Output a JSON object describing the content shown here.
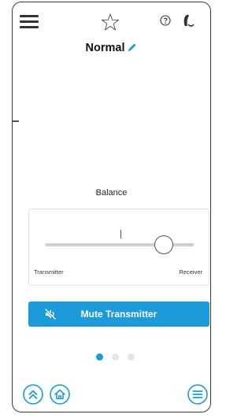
{
  "header": {
    "icons": [
      "menu-icon",
      "star-icon",
      "help-icon",
      "hearing-aid-icon"
    ]
  },
  "program": {
    "name": "Normal",
    "edit_icon": "pencil-icon"
  },
  "balance": {
    "title": "Balance",
    "left_label": "Transmitter",
    "right_label": "Receiver",
    "value_fraction": 0.8
  },
  "mute_button": {
    "label": "Mute Transmitter",
    "icon": "speaker-muted-icon"
  },
  "pager": {
    "count": 3,
    "active_index": 0
  },
  "bottom_bar": {
    "icons": [
      "chevron-double-up-icon",
      "home-icon",
      "list-icon"
    ]
  },
  "colors": {
    "accent": "#1c9ad9",
    "inactive_dot": "#e6e6e6",
    "text": "#111111"
  }
}
